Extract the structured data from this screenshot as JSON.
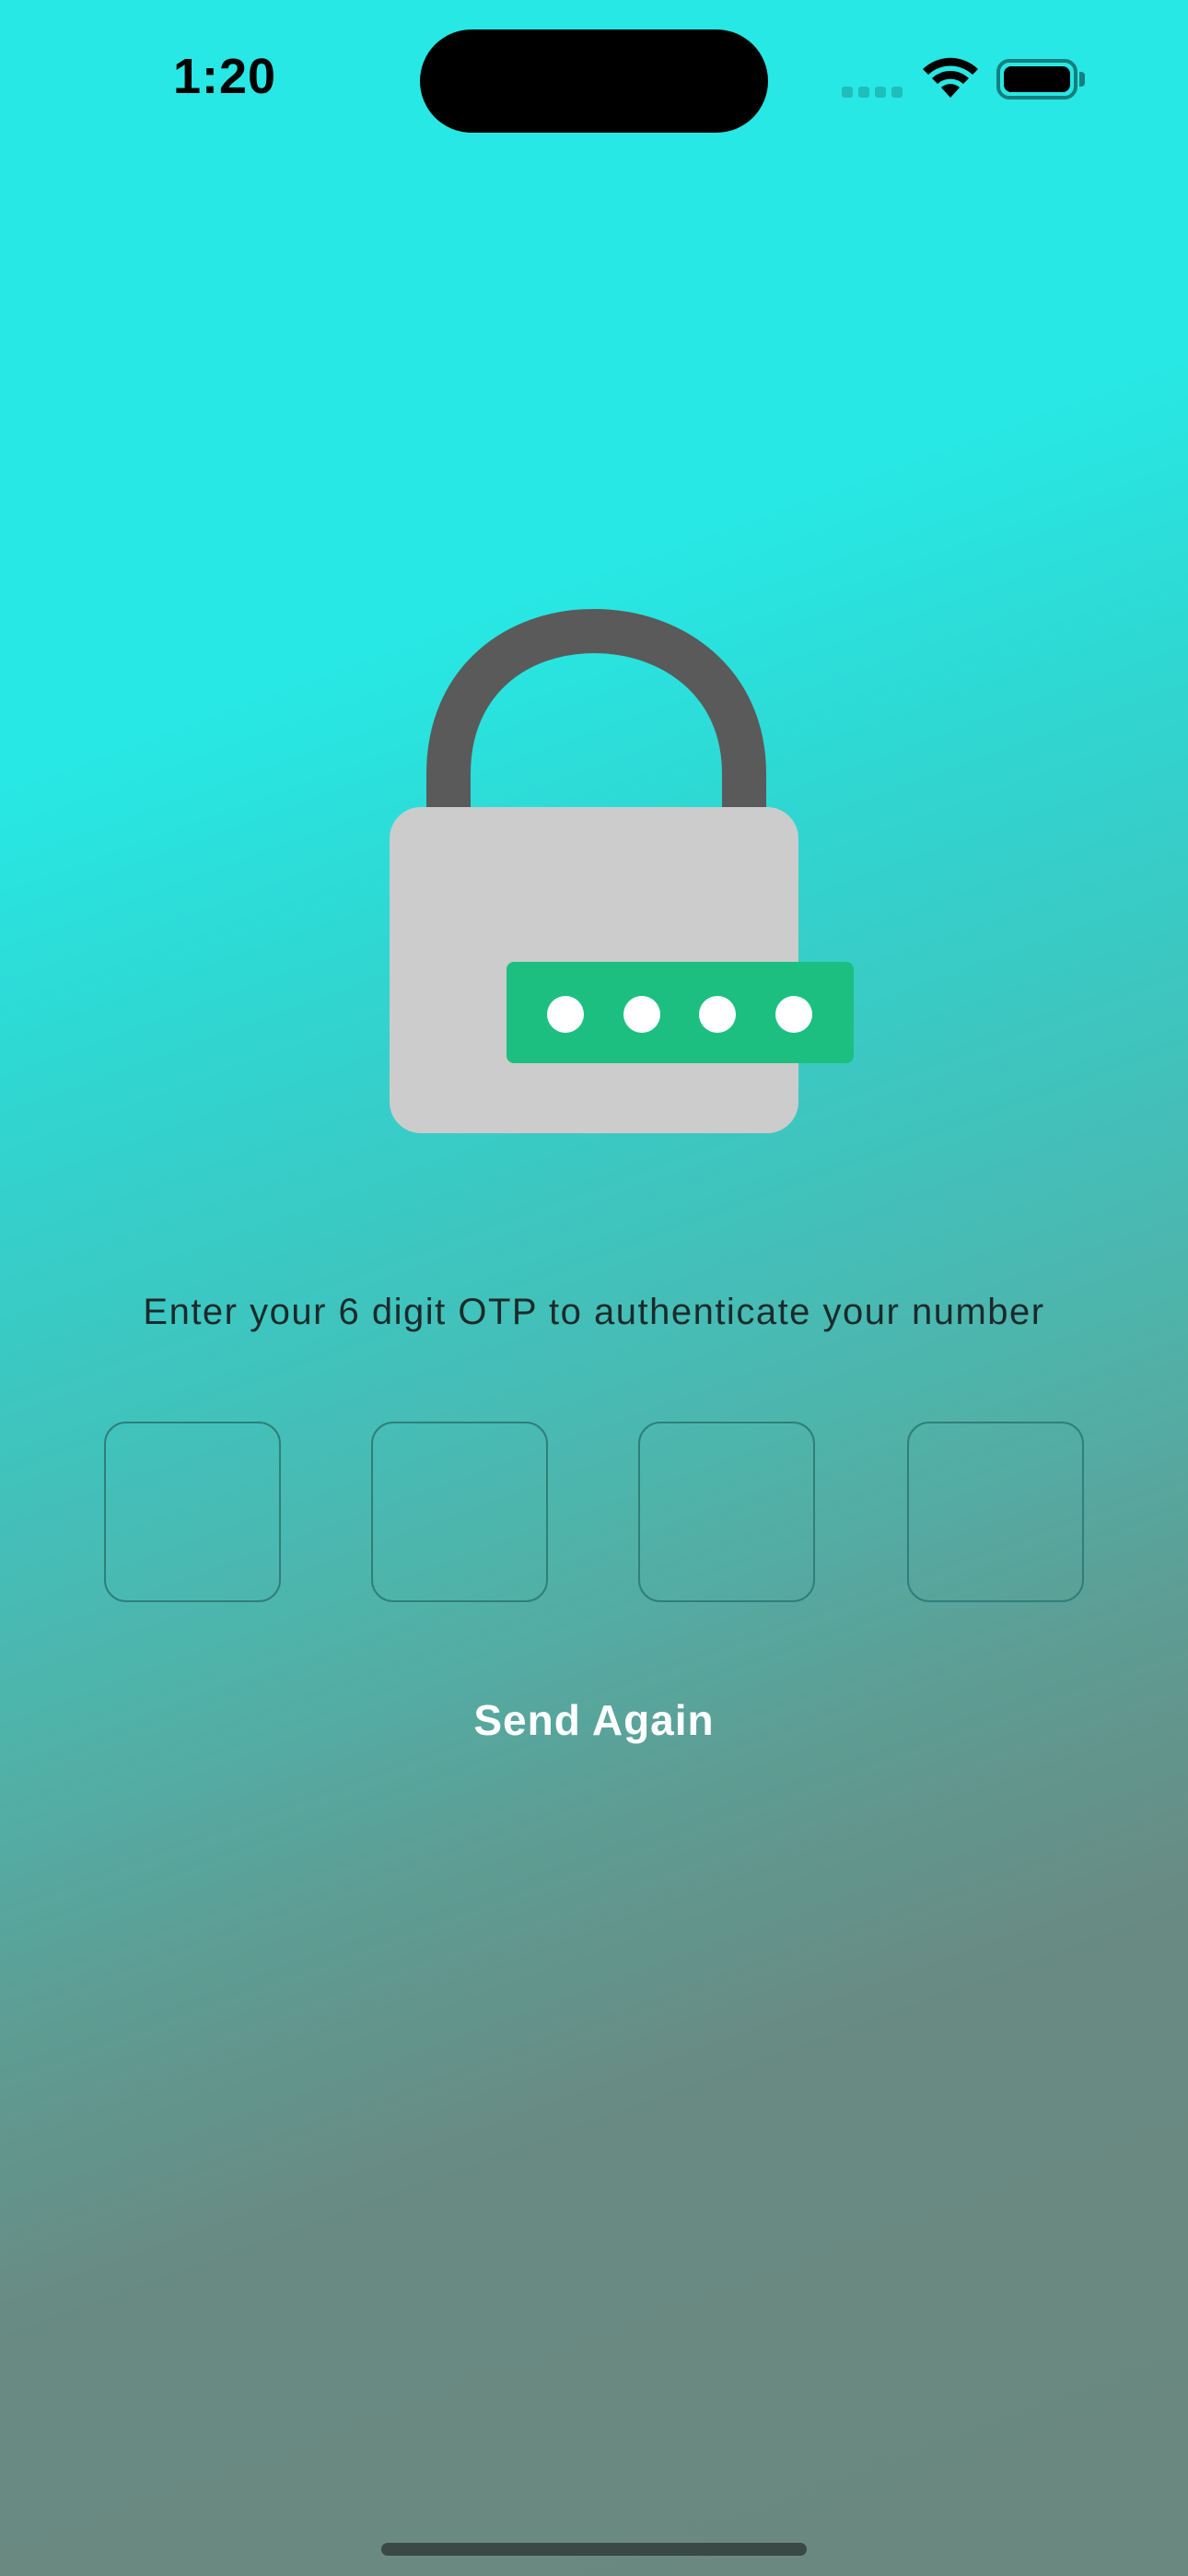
{
  "status_bar": {
    "time": "1:20"
  },
  "colors": {
    "background_top": "#27e8e4",
    "background_bottom": "#6a8880",
    "lock_shackle": "#5a5a5a",
    "lock_body": "#cccccc",
    "password_badge": "#1dbf80",
    "send_again_text": "#ffffff"
  },
  "instruction": {
    "text": "Enter your 6 digit OTP to authenticate your number"
  },
  "otp": {
    "digits": [
      "",
      "",
      "",
      ""
    ]
  },
  "actions": {
    "send_again_label": "Send Again"
  }
}
